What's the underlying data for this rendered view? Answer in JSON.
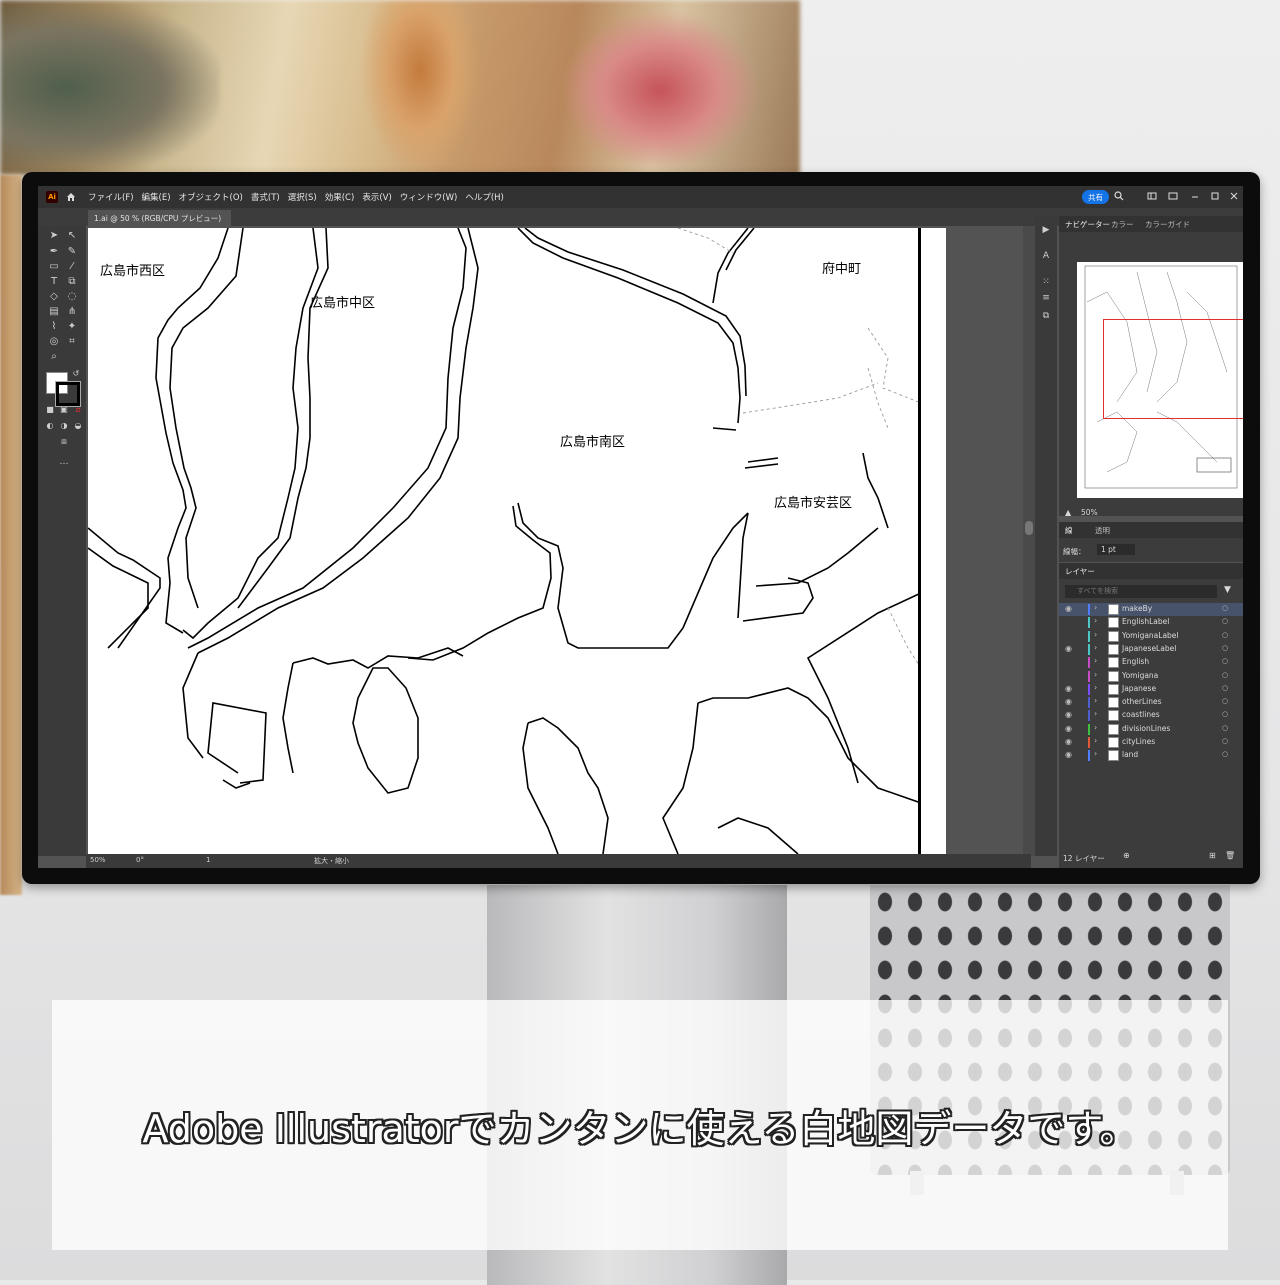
{
  "app": {
    "logo": "Ai",
    "menu": [
      "ファイル(F)",
      "編集(E)",
      "オブジェクト(O)",
      "書式(T)",
      "選択(S)",
      "効果(C)",
      "表示(V)",
      "ウィンドウ(W)",
      "ヘルプ(H)"
    ],
    "share_label": "共有",
    "doc_tab": "1.ai @ 50 % (RGB/CPU プレビュー)",
    "accent_color": "#1473e6"
  },
  "map": {
    "labels": [
      "広島市西区",
      "広島市中区",
      "広島市南区",
      "府中町",
      "広島市安芸区"
    ]
  },
  "statusbar": {
    "zoom": "50%",
    "angle": "0°",
    "artboard": "1",
    "mode": "拡大・縮小"
  },
  "navigator": {
    "tabs": [
      "ナビゲーター",
      "カラー",
      "カラーガイド"
    ],
    "zoom": "50%"
  },
  "stroke_panel": {
    "tabs": [
      "線",
      "透明"
    ],
    "weight_label": "線幅：",
    "weight_value": "1 pt"
  },
  "layers_panel": {
    "tab": "レイヤー",
    "search_placeholder": "すべてを検索",
    "layers": [
      {
        "name": "makeBy",
        "color": "#4f7fff",
        "visible": true
      },
      {
        "name": "EnglishLabel",
        "color": "#4dc6c6",
        "visible": false
      },
      {
        "name": "YomiganaLabel",
        "color": "#4dc6c6",
        "visible": false
      },
      {
        "name": "JapaneseLabel",
        "color": "#4dc6c6",
        "visible": true
      },
      {
        "name": "English",
        "color": "#c64dc6",
        "visible": false
      },
      {
        "name": "Yomigana",
        "color": "#c64dc6",
        "visible": false
      },
      {
        "name": "Japanese",
        "color": "#7a4dff",
        "visible": true
      },
      {
        "name": "otherLines",
        "color": "#4f5fd0",
        "visible": true
      },
      {
        "name": "coastlines",
        "color": "#4f5fd0",
        "visible": true
      },
      {
        "name": "divisionLines",
        "color": "#3fbf3f",
        "visible": true
      },
      {
        "name": "cityLines",
        "color": "#e05a3a",
        "visible": true
      },
      {
        "name": "land",
        "color": "#4f7fff",
        "visible": true
      }
    ],
    "footer": "12 レイヤー"
  },
  "caption": "Adobe Illustratorでカンタンに使える白地図データです。"
}
